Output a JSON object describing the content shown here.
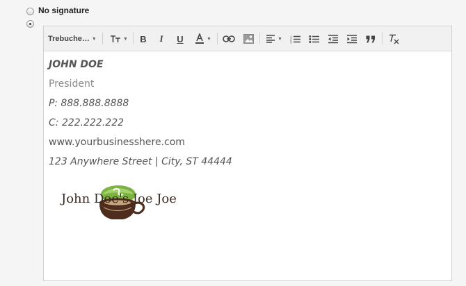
{
  "signature_options": {
    "no_signature_label": "No signature",
    "selected": "custom"
  },
  "toolbar": {
    "font_family": "Trebuche…",
    "buttons": [
      {
        "name": "text-size-button",
        "icon": "text-size-icon"
      },
      {
        "name": "bold-button",
        "icon": "bold-icon"
      },
      {
        "name": "italic-button",
        "icon": "italic-icon"
      },
      {
        "name": "underline-button",
        "icon": "underline-icon"
      },
      {
        "name": "text-color-button",
        "icon": "text-color-icon"
      },
      {
        "name": "link-button",
        "icon": "link-icon"
      },
      {
        "name": "insert-image-button",
        "icon": "image-icon"
      },
      {
        "name": "align-button",
        "icon": "align-left-icon"
      },
      {
        "name": "numbered-list-button",
        "icon": "numbered-list-icon"
      },
      {
        "name": "bulleted-list-button",
        "icon": "bulleted-list-icon"
      },
      {
        "name": "indent-less-button",
        "icon": "indent-less-icon"
      },
      {
        "name": "indent-more-button",
        "icon": "indent-more-icon"
      },
      {
        "name": "quote-button",
        "icon": "quote-icon"
      },
      {
        "name": "remove-formatting-button",
        "icon": "clear-format-icon"
      }
    ]
  },
  "signature": {
    "name": "JOHN DOE",
    "title": "President",
    "phone": "P: 888.888.8888",
    "cell": "C: 222.222.222",
    "website": "www.yourbusinesshere.com",
    "address": "123 Anywhere Street | City, ST 44444",
    "logo_text": "John Doe's Joe Joe"
  },
  "colors": {
    "logo_green": "#7cb342",
    "logo_brown": "#4e2c1e",
    "text_gray": "#555555"
  }
}
